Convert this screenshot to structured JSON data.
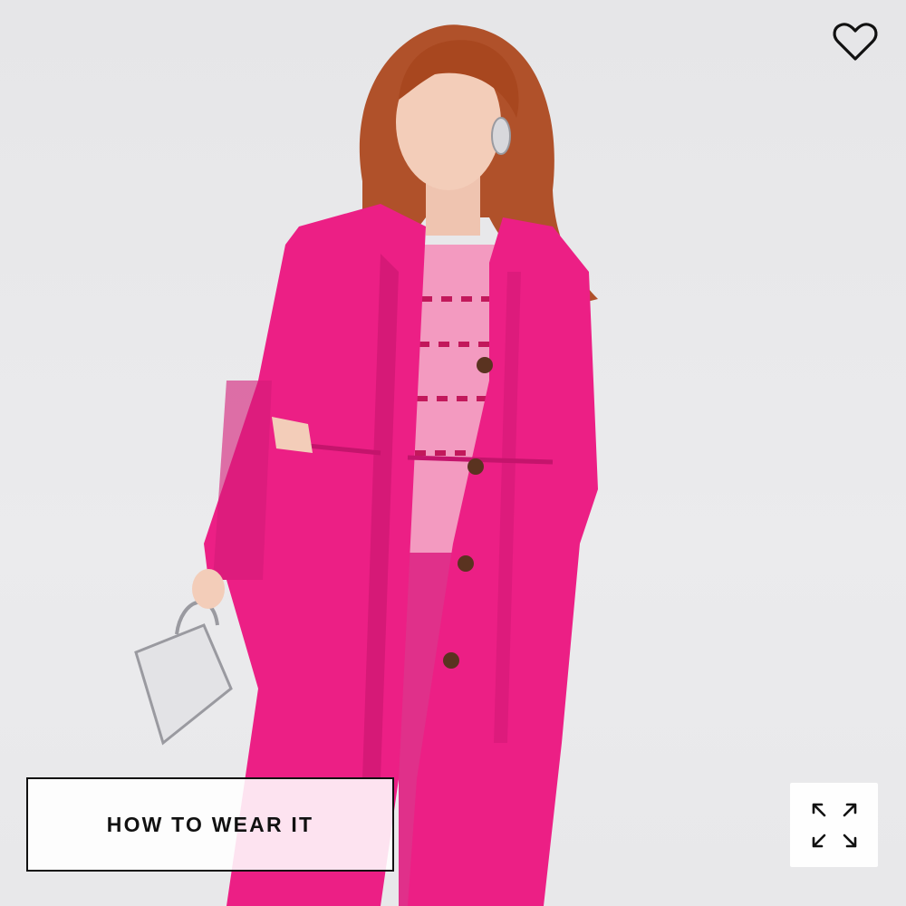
{
  "product_image": {
    "alt": "",
    "colors": {
      "coat": "#ec1f85",
      "coat_shadow": "#c4146c",
      "sweater": "#f39ac0",
      "pants": "#e0308a",
      "hair": "#b0512a",
      "background": "#e8e8ea"
    }
  },
  "wishlist": {
    "icon": "heart-outline-icon"
  },
  "how_to_wear": {
    "label": "HOW TO WEAR IT"
  },
  "expand": {
    "icon": "expand-arrows-icon"
  }
}
